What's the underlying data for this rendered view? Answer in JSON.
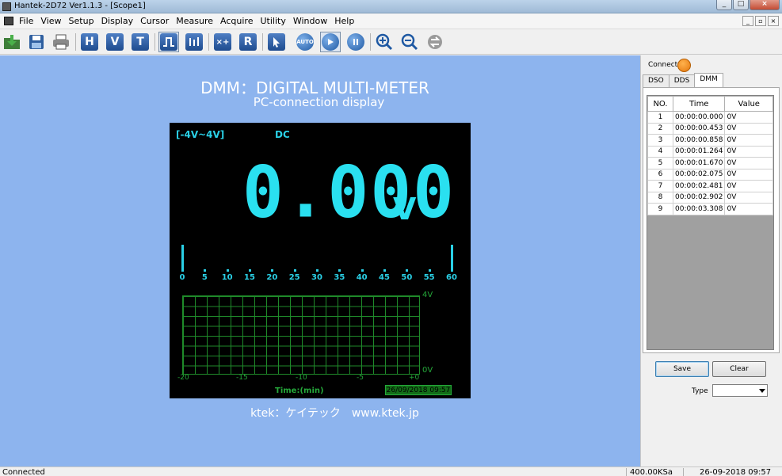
{
  "window": {
    "title": "Hantek-2D72 Ver1.1.3 - [Scope1]"
  },
  "menu": [
    "File",
    "View",
    "Setup",
    "Display",
    "Cursor",
    "Measure",
    "Acquire",
    "Utility",
    "Window",
    "Help"
  ],
  "toolbar": {
    "labels": {
      "h": "H",
      "v": "V",
      "t": "T",
      "r": "R",
      "auto": "AUTO"
    }
  },
  "canvas": {
    "title": "DMM：DIGITAL MULTI-METER",
    "subtitle": "PC-connection display",
    "footer": "ktek：ケイテック　www.ktek.jp",
    "background": "#8db4ee"
  },
  "meter": {
    "range": "[-4V~4V]",
    "mode": "DC",
    "reading": "0.000",
    "unit": "V",
    "scale": [
      "0",
      "5",
      "10",
      "15",
      "20",
      "25",
      "30",
      "35",
      "40",
      "45",
      "50",
      "55",
      "60"
    ],
    "y_top": "4V",
    "y_bottom": "0V",
    "x_labels": [
      "-20",
      "-15",
      "-10",
      "-5",
      "+0"
    ],
    "time_label": "Time:(min)",
    "datetime": "26/09/2018  09:57",
    "digit_color": "#2ae0f0",
    "grid_color": "#1f8a2a"
  },
  "right_panel": {
    "connect_label": "Connect:",
    "connect_color": "#f08a1c",
    "tabs": [
      "DSO",
      "DDS",
      "DMM"
    ],
    "active_tab": "DMM",
    "table": {
      "headers": [
        "NO.",
        "Time",
        "Value"
      ],
      "rows": [
        [
          "1",
          "00:00:00.000",
          "0V"
        ],
        [
          "2",
          "00:00:00.453",
          "0V"
        ],
        [
          "3",
          "00:00:00.858",
          "0V"
        ],
        [
          "4",
          "00:00:01.264",
          "0V"
        ],
        [
          "5",
          "00:00:01.670",
          "0V"
        ],
        [
          "6",
          "00:00:02.075",
          "0V"
        ],
        [
          "7",
          "00:00:02.481",
          "0V"
        ],
        [
          "8",
          "00:00:02.902",
          "0V"
        ],
        [
          "9",
          "00:00:03.308",
          "0V"
        ]
      ]
    },
    "save_label": "Save",
    "clear_label": "Clear",
    "type_label": "Type",
    "type_value": ""
  },
  "status": {
    "left": "Connected",
    "rate": "400.00KSa",
    "datetime": "26-09-2018   09:57"
  }
}
